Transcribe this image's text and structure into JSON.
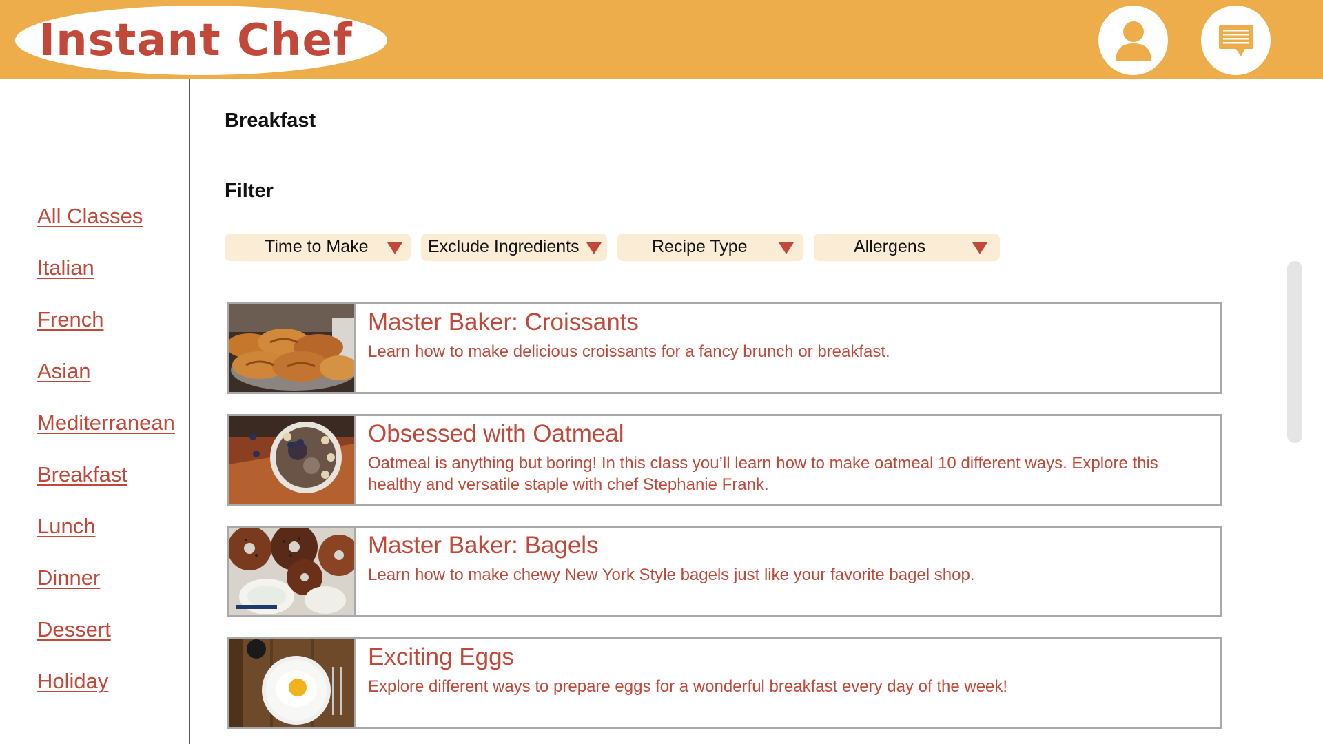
{
  "header": {
    "logo_text": "Instant Chef",
    "brand_color": "#ecad4a",
    "accent_color": "#c2493a",
    "profile_icon": "user-icon",
    "messages_icon": "message-icon"
  },
  "sidebar": {
    "items": [
      {
        "label": "All Classes"
      },
      {
        "label": "Italian"
      },
      {
        "label": "French"
      },
      {
        "label": "Asian"
      },
      {
        "label": "Mediterranean "
      },
      {
        "label": "Breakfast"
      },
      {
        "label": "Lunch"
      },
      {
        "label": "Dinner"
      },
      {
        "label": "Dessert"
      },
      {
        "label": "Holiday"
      }
    ]
  },
  "main": {
    "page_title": "Breakfast",
    "filter_heading": "Filter",
    "filters": [
      {
        "label": "Time to Make"
      },
      {
        "label": "Exclude Ingredients"
      },
      {
        "label": "Recipe Type"
      },
      {
        "label": "Allergens"
      }
    ],
    "classes": [
      {
        "title": "Master Baker: Croissants",
        "description": "Learn how to make delicious croissants for a fancy brunch or breakfast.",
        "image": "croissants-photo"
      },
      {
        "title": "Obsessed with Oatmeal",
        "description": "Oatmeal is anything but boring! In this class you’ll learn how to make oatmeal 10 different ways. Explore this healthy and versatile staple with chef Stephanie Frank.",
        "image": "oatmeal-bowl-photo"
      },
      {
        "title": "Master Baker: Bagels",
        "description": "Learn how to make chewy New York Style bagels just like your favorite bagel shop.",
        "image": "bagels-photo"
      },
      {
        "title": "Exciting Eggs",
        "description": "Explore different ways to prepare eggs for a wonderful breakfast every day of the week!",
        "image": "fried-egg-photo"
      }
    ]
  }
}
